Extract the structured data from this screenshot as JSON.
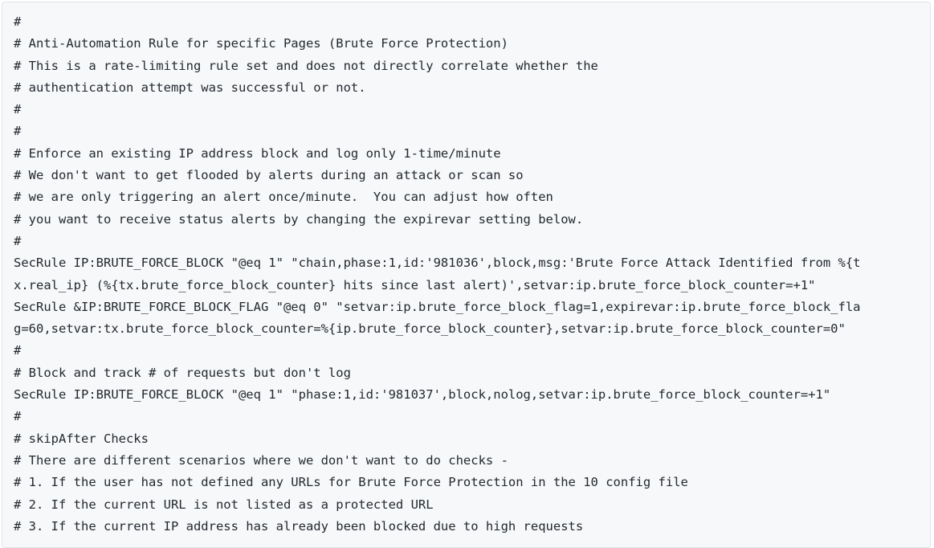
{
  "code_block": {
    "lines": [
      "#",
      "# Anti-Automation Rule for specific Pages (Brute Force Protection)",
      "# This is a rate-limiting rule set and does not directly correlate whether the",
      "# authentication attempt was successful or not.",
      "#",
      "#",
      "# Enforce an existing IP address block and log only 1-time/minute",
      "# We don't want to get flooded by alerts during an attack or scan so",
      "# we are only triggering an alert once/minute.  You can adjust how often",
      "# you want to receive status alerts by changing the expirevar setting below.",
      "#",
      "SecRule IP:BRUTE_FORCE_BLOCK \"@eq 1\" \"chain,phase:1,id:'981036',block,msg:'Brute Force Attack Identified from %{t",
      "x.real_ip} (%{tx.brute_force_block_counter} hits since last alert)',setvar:ip.brute_force_block_counter=+1\"",
      "SecRule &IP:BRUTE_FORCE_BLOCK_FLAG \"@eq 0\" \"setvar:ip.brute_force_block_flag=1,expirevar:ip.brute_force_block_fla",
      "g=60,setvar:tx.brute_force_block_counter=%{ip.brute_force_block_counter},setvar:ip.brute_force_block_counter=0\"",
      "#",
      "# Block and track # of requests but don't log",
      "SecRule IP:BRUTE_FORCE_BLOCK \"@eq 1\" \"phase:1,id:'981037',block,nolog,setvar:ip.brute_force_block_counter=+1\"",
      "#",
      "# skipAfter Checks",
      "# There are different scenarios where we don't want to do checks -",
      "# 1. If the user has not defined any URLs for Brute Force Protection in the 10 config file",
      "# 2. If the current URL is not listed as a protected URL",
      "# 3. If the current IP address has already been blocked due to high requests"
    ]
  }
}
